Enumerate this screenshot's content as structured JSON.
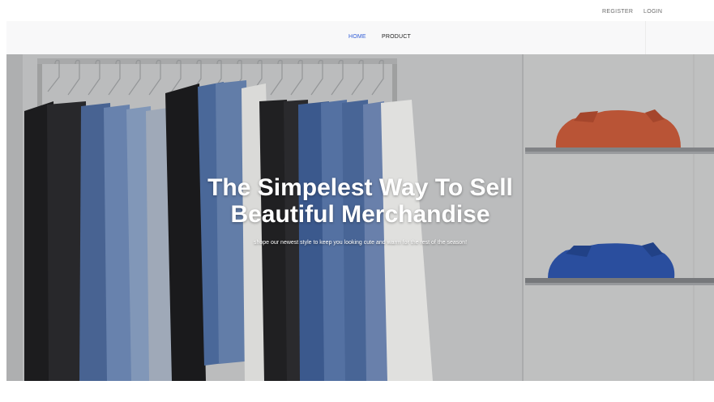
{
  "top_bar": {
    "register_label": "REGISTER",
    "login_label": "LOGIN"
  },
  "nav": {
    "home_label": "HOME",
    "product_label": "PRODUCT"
  },
  "hero": {
    "title_line1": "The Simpelest Way To Sell",
    "title_line2": "Beautiful Merchandise",
    "subtitle": "shope our newest style to keep you looking cute and warm for the rest of the season!"
  },
  "colors": {
    "accent": "#2f5bd6",
    "nav_bg": "#f8f8f9",
    "hero_text": "#ffffff"
  }
}
